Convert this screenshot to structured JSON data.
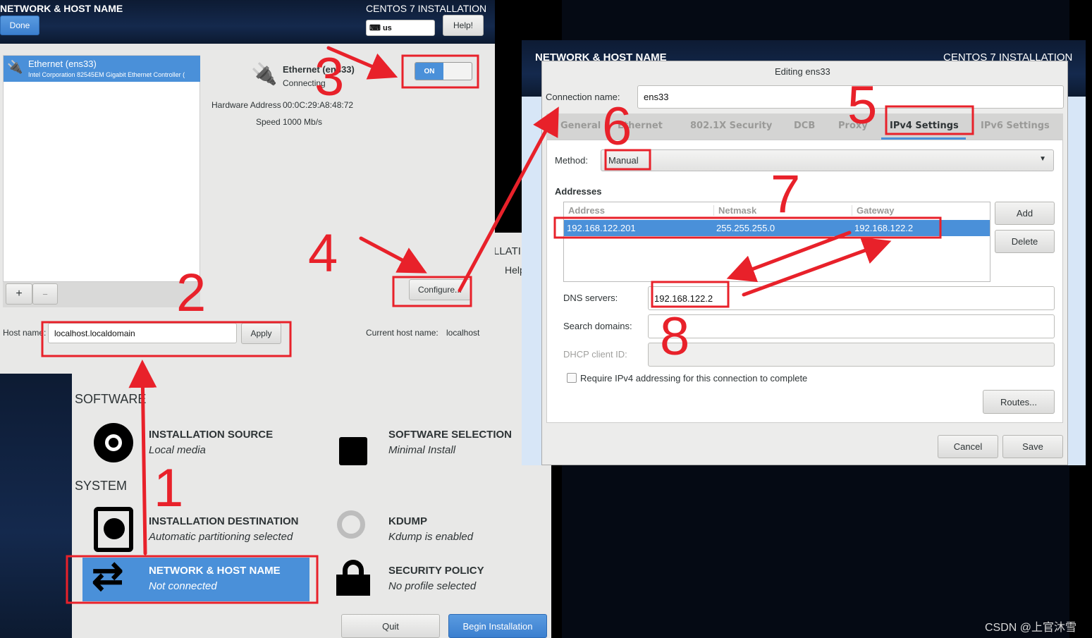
{
  "left_window": {
    "title": "NETWORK & HOST NAME",
    "done": "Done",
    "product": "CENTOS 7 INSTALLATION",
    "keyboard": "us",
    "help": "Help!",
    "device": {
      "name": "Ethernet (ens33)",
      "desc": "Intel Corporation 82545EM Gigabit Ethernet Controller (",
      "status": "Connecting",
      "hw_label": "Hardware Address",
      "hw_value": "00:0C:29:A8:48:72",
      "speed_label": "Speed",
      "speed_value": "1000 Mb/s",
      "toggle": "ON"
    },
    "add": "+",
    "remove": "−",
    "configure": "Configure...",
    "host_label": "Host name:",
    "host_value": "localhost.localdomain",
    "apply": "Apply",
    "current_label": "Current host name:",
    "current_value": "localhost"
  },
  "summary": {
    "partial_title": "LLATI",
    "partial_help": "Help",
    "software": "SOFTWARE",
    "system": "SYSTEM",
    "spokes": [
      {
        "title": "INSTALLATION SOURCE",
        "status": "Local media"
      },
      {
        "title": "SOFTWARE SELECTION",
        "status": "Minimal Install"
      },
      {
        "title": "INSTALLATION DESTINATION",
        "status": "Automatic partitioning selected"
      },
      {
        "title": "KDUMP",
        "status": "Kdump is enabled"
      },
      {
        "title": "NETWORK & HOST NAME",
        "status": "Not connected"
      },
      {
        "title": "SECURITY POLICY",
        "status": "No profile selected"
      }
    ],
    "quit": "Quit",
    "begin": "Begin Installation"
  },
  "right_window": {
    "title": "NETWORK & HOST NAME",
    "product": "CENTOS 7 INSTALLATION"
  },
  "dialog": {
    "title": "Editing ens33",
    "conn_label": "Connection name:",
    "conn_value": "ens33",
    "tabs": [
      "General",
      "Ethernet",
      "802.1X Security",
      "DCB",
      "Proxy",
      "IPv4 Settings",
      "IPv6 Settings"
    ],
    "active_tab": "IPv4 Settings",
    "method_label": "Method:",
    "method_value": "Manual",
    "addresses_label": "Addresses",
    "columns": [
      "Address",
      "Netmask",
      "Gateway"
    ],
    "rows": [
      [
        "192.168.122.201",
        "255.255.255.0",
        "192.168.122.2"
      ]
    ],
    "add": "Add",
    "delete": "Delete",
    "dns_label": "DNS servers:",
    "dns_value": "192.168.122.2",
    "search_label": "Search domains:",
    "search_value": "",
    "dhcp_label": "DHCP client ID:",
    "require_label": "Require IPv4 addressing for this connection to complete",
    "require_checked": false,
    "routes": "Routes...",
    "cancel": "Cancel",
    "save": "Save"
  },
  "annotations": {
    "numbers": [
      "1",
      "2",
      "3",
      "4",
      "5",
      "6",
      "7",
      "8"
    ],
    "color": "#e8212a"
  },
  "watermark": "CSDN @上官沐雪",
  "colors": {
    "accent": "#4a90d9",
    "header": "#14294d",
    "annotation": "#e8212a"
  }
}
